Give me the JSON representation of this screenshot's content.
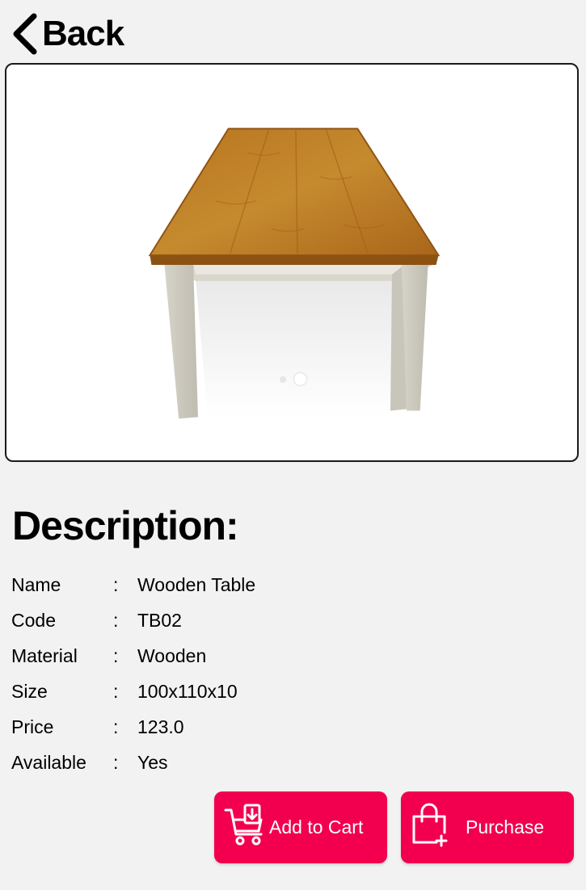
{
  "nav": {
    "back_label": "Back",
    "back_icon": "chevron-left-icon"
  },
  "carousel": {
    "image": "wooden-table-photo",
    "page_count": 2,
    "active_page": 2
  },
  "description": {
    "title": "Description:",
    "separator": ":",
    "rows": [
      {
        "label": "Name",
        "value": "Wooden Table"
      },
      {
        "label": "Code",
        "value": "TB02"
      },
      {
        "label": "Material",
        "value": "Wooden"
      },
      {
        "label": "Size",
        "value": "100x110x10"
      },
      {
        "label": "Price",
        "value": "123.0"
      },
      {
        "label": "Available",
        "value": "Yes"
      }
    ]
  },
  "actions": {
    "add_to_cart_label": "Add to Cart",
    "add_to_cart_icon": "cart-download-icon",
    "purchase_label": "Purchase",
    "purchase_icon": "shopping-bag-plus-icon"
  },
  "colors": {
    "accent": "#f2004f",
    "background": "#f2f2f2",
    "text": "#000000"
  }
}
